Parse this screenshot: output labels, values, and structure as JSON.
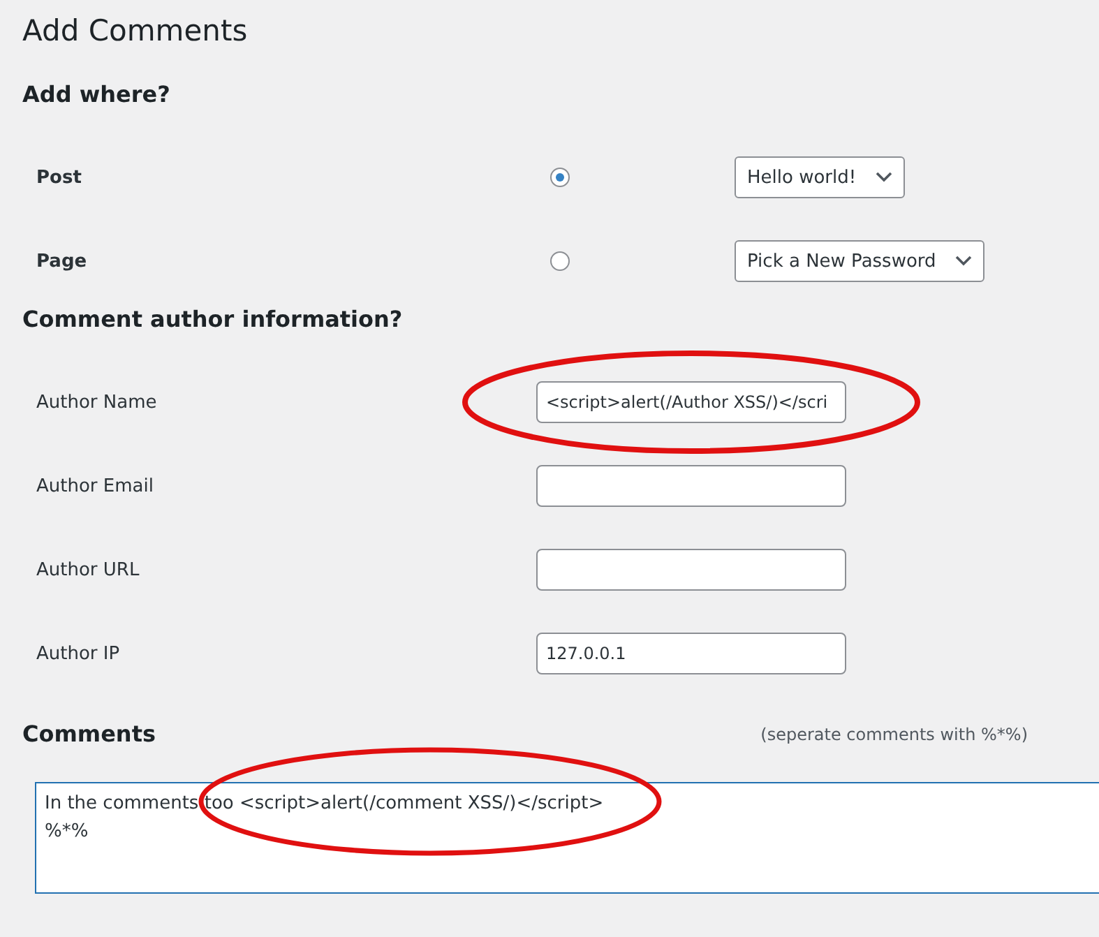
{
  "title": "Add Comments",
  "where": {
    "heading": "Add where?",
    "options": [
      {
        "label": "Post",
        "selected": true,
        "choice": "Hello world!"
      },
      {
        "label": "Page",
        "selected": false,
        "choice": "Pick a New Password"
      }
    ]
  },
  "author": {
    "heading": "Comment author information?",
    "fields": [
      {
        "label": "Author Name",
        "value": "<script>alert(/Author XSS/)</scri",
        "highlighted": true
      },
      {
        "label": "Author Email",
        "highlighted": false
      },
      {
        "label": "Author URL",
        "highlighted": false
      },
      {
        "label": "Author IP",
        "value": "127.0.0.1",
        "highlighted": false
      }
    ]
  },
  "comments": {
    "heading": "Comments",
    "hint": "(seperate comments with %*%)",
    "lines": [
      "In the comments too <script>alert(/comment XSS/)</script>",
      "%*%"
    ],
    "highlighted": true
  }
}
